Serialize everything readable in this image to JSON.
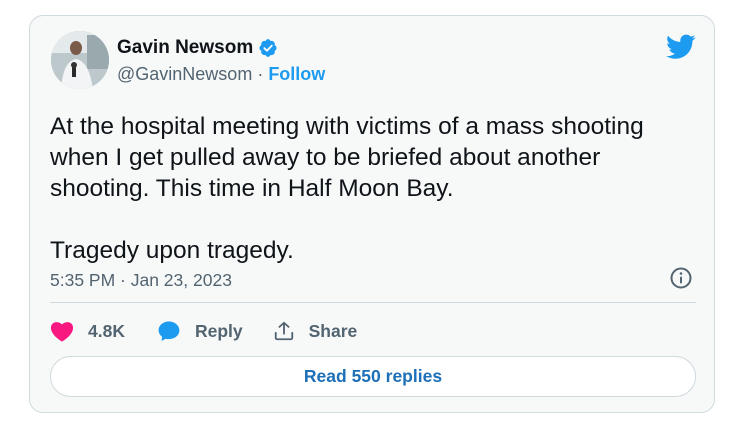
{
  "author": {
    "name": "Gavin Newsom",
    "handle": "@GavinNewsom",
    "separator": " · ",
    "follow_label": "Follow",
    "verified": true
  },
  "tweet": {
    "text": "At the hospital meeting with victims of a mass shooting\nwhen I get pulled away to be briefed about another\nshooting. This time in Half Moon Bay.\n\nTragedy upon tragedy.",
    "timestamp": "5:35 PM · Jan 23, 2023"
  },
  "actions": {
    "likes": "4.8K",
    "reply_label": "Reply",
    "share_label": "Share"
  },
  "read_replies_label": "Read 550 replies",
  "icons": {
    "brand": "twitter-bird-icon",
    "like": "heart-icon",
    "reply": "speech-bubble-icon",
    "share": "share-icon",
    "info": "info-icon",
    "verified": "verified-badge-icon"
  },
  "colors": {
    "brand_blue": "#1d9bf0",
    "like_pink": "#f91880",
    "text_primary": "#0f1419",
    "text_secondary": "#536471",
    "border": "#cfd9de"
  }
}
